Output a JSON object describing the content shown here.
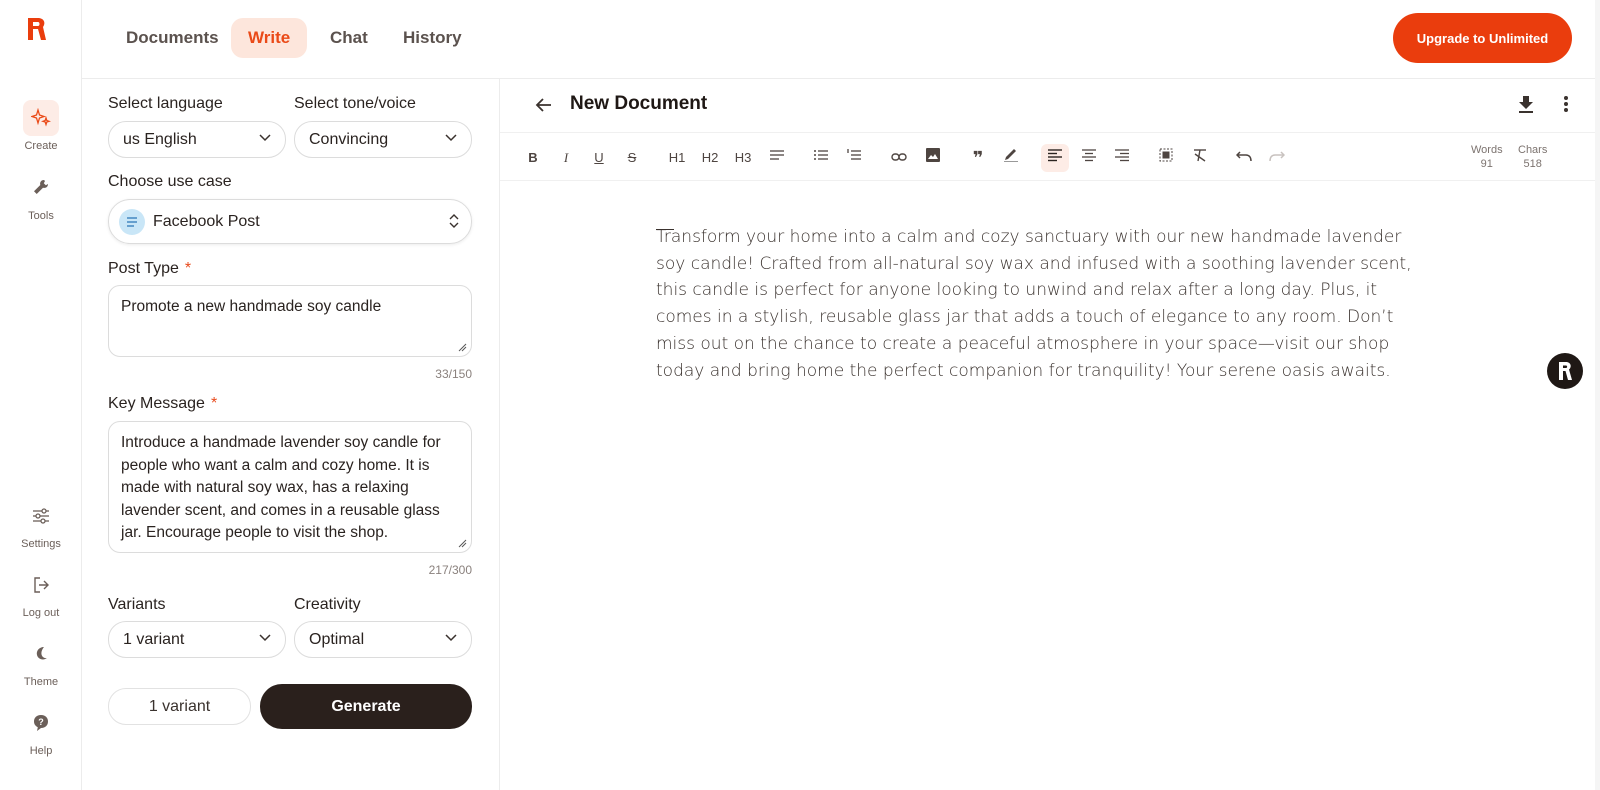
{
  "rail": {
    "items": [
      {
        "label": "Create",
        "icon": "sparkle-icon"
      },
      {
        "label": "Tools",
        "icon": "wrench-icon"
      },
      {
        "label": "Settings",
        "icon": "sliders-icon"
      },
      {
        "label": "Log out",
        "icon": "logout-icon"
      },
      {
        "label": "Theme",
        "icon": "moon-icon"
      },
      {
        "label": "Help",
        "icon": "help-icon"
      }
    ]
  },
  "tabs": [
    {
      "label": "Documents"
    },
    {
      "label": "Write"
    },
    {
      "label": "Chat"
    },
    {
      "label": "History"
    }
  ],
  "upgrade_label": "Upgrade to Unlimited",
  "form": {
    "language_label": "Select language",
    "language_value": "us English",
    "tone_label": "Select tone/voice",
    "tone_value": "Convincing",
    "usecase_label": "Choose use case",
    "usecase_value": "Facebook Post",
    "post_type_label": "Post Type",
    "post_type_value": "Promote a new handmade soy candle",
    "post_type_counter": "33/150",
    "key_message_label": "Key Message",
    "key_message_value": "Introduce a handmade lavender soy candle for people who want a calm and cozy home. It is made with natural soy wax, has a relaxing lavender scent, and comes in a reusable glass jar. Encourage people to visit the shop.",
    "key_message_counter": "217/300",
    "required_mark": "*",
    "variants_label": "Variants",
    "variants_value": "1 variant",
    "creativity_label": "Creativity",
    "creativity_value": "Optimal",
    "variant_pill": "1 variant",
    "generate_label": "Generate"
  },
  "editor": {
    "title": "New Document",
    "words_label": "Words",
    "words_value": "91",
    "chars_label": "Chars",
    "chars_value": "518",
    "toolbar": [
      "B",
      "I",
      "U",
      "S",
      "H1",
      "H2",
      "H3"
    ],
    "content": "Transform your home into a calm and cozy sanctuary with our new handmade lavender soy candle! Crafted from all-natural soy wax and infused with a soothing lavender scent, this candle is perfect for anyone looking to unwind and relax after a long day. Plus, it comes in a stylish, reusable glass jar that adds a touch of elegance to any room. Don’t miss out on the chance to create a peaceful atmosphere in your space—visit our shop today and bring home the perfect companion for tranquility! Your serene oasis awaits."
  },
  "colors": {
    "accent": "#ea3d0d",
    "dark": "#2a201c",
    "tab_active_bg": "#fde6dc"
  }
}
